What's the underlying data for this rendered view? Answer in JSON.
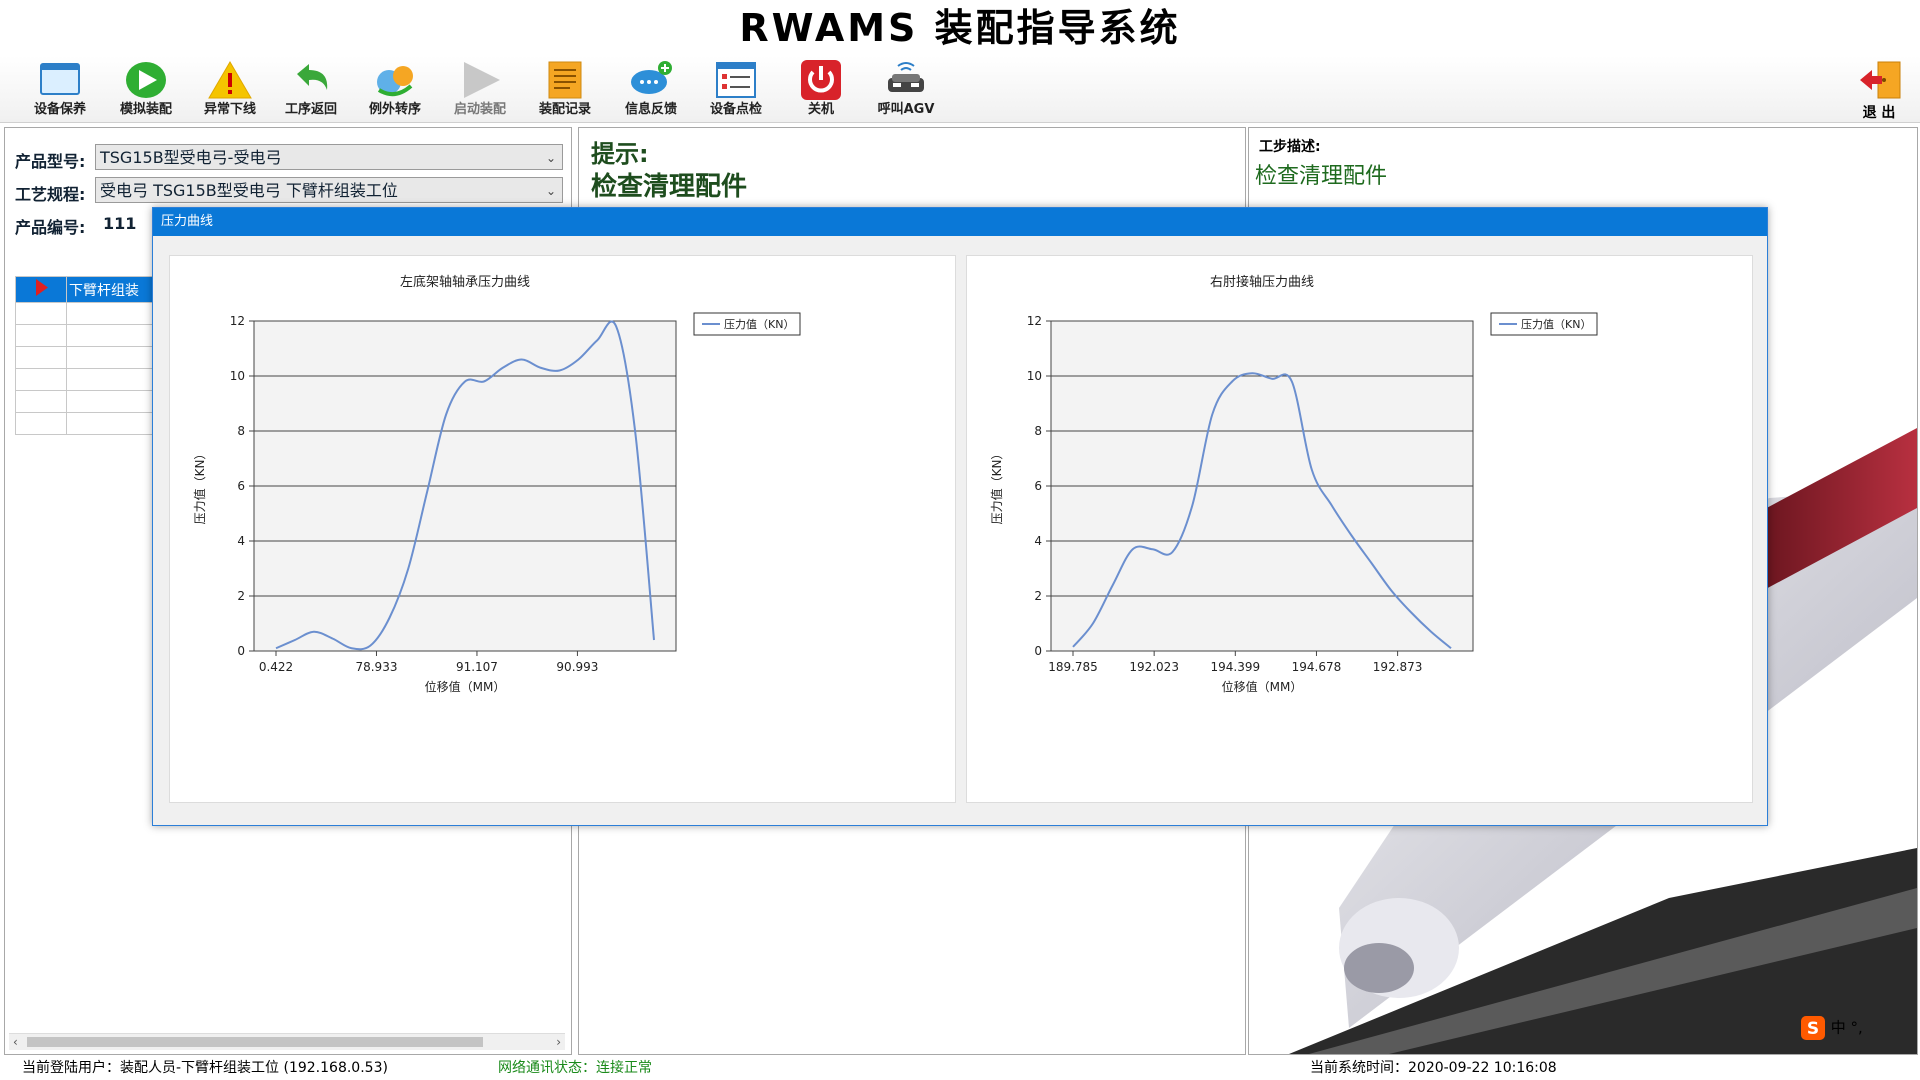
{
  "app": {
    "title": "RWAMS 装配指导系统"
  },
  "toolbar": {
    "items": [
      {
        "label": "设备保养",
        "icon": "monitor-icon"
      },
      {
        "label": "模拟装配",
        "icon": "play-green-icon"
      },
      {
        "label": "异常下线",
        "icon": "warning-icon"
      },
      {
        "label": "工序返回",
        "icon": "return-arrow-icon"
      },
      {
        "label": "例外转序",
        "icon": "exception-transfer-icon"
      },
      {
        "label": "启动装配",
        "icon": "play-disabled-icon"
      },
      {
        "label": "装配记录",
        "icon": "document-icon"
      },
      {
        "label": "信息反馈",
        "icon": "chat-icon"
      },
      {
        "label": "设备点检",
        "icon": "checklist-icon"
      },
      {
        "label": "关机",
        "icon": "power-icon"
      },
      {
        "label": "呼叫AGV",
        "icon": "agv-icon"
      }
    ],
    "exit_label": "退 出"
  },
  "left": {
    "product_model_label": "产品型号:",
    "product_model_value": "TSG15B型受电弓-受电弓",
    "process_label": "工艺规程:",
    "process_value": "受电弓 TSG15B型受电弓 下臂杆组装工位",
    "product_no_label": "产品编号:",
    "product_no_value": "111",
    "table_rows": [
      "下臂杆组装",
      "",
      "",
      "",
      "",
      "",
      ""
    ]
  },
  "middle": {
    "hint_label": "提示:",
    "hint_text": "检查清理配件"
  },
  "right": {
    "step_label": "工步描述:",
    "step_text": "检查清理配件"
  },
  "dialog": {
    "title": "压力曲线"
  },
  "chart_data": [
    {
      "type": "line",
      "title": "左底架轴轴承压力曲线",
      "xlabel": "位移值（MM）",
      "ylabel": "压力值（KN）",
      "ylim": [
        0,
        12
      ],
      "yticks": [
        "0",
        "2",
        "4",
        "6",
        "8",
        "10",
        "12"
      ],
      "xtick_labels": [
        "0.422",
        "78.933",
        "91.107",
        "90.993"
      ],
      "legend": "top-right",
      "grid": true,
      "series": [
        {
          "name": "压力值（KN）",
          "color": "#6b8fcf",
          "values": [
            0.1,
            0.4,
            0.7,
            0.45,
            0.1,
            0.2,
            1.2,
            3.0,
            5.8,
            8.6,
            9.8,
            9.8,
            10.3,
            10.6,
            10.3,
            10.2,
            10.6,
            11.3,
            11.8,
            8.0,
            0.4
          ]
        }
      ]
    },
    {
      "type": "line",
      "title": "右肘接轴压力曲线",
      "xlabel": "位移值（MM）",
      "ylabel": "压力值（KN）",
      "ylim": [
        0,
        12
      ],
      "yticks": [
        "0",
        "2",
        "4",
        "6",
        "8",
        "10",
        "12"
      ],
      "xtick_labels": [
        "189.785",
        "192.023",
        "194.399",
        "194.678",
        "192.873"
      ],
      "legend": "top-right",
      "grid": true,
      "series": [
        {
          "name": "压力值（KN）",
          "color": "#6b8fcf",
          "values": [
            0.15,
            1.0,
            2.4,
            3.7,
            3.7,
            3.6,
            5.3,
            8.6,
            9.8,
            10.1,
            9.9,
            9.8,
            6.6,
            5.3,
            4.2,
            3.2,
            2.2,
            1.4,
            0.7,
            0.1
          ]
        }
      ]
    }
  ],
  "status": {
    "user": "当前登陆用户：装配人员-下臂杆组装工位 (192.168.0.53)",
    "network_label": "网络通讯状态：",
    "network_value": "连接正常",
    "time": "当前系统时间：2020-09-22 10:16:08"
  },
  "ime": {
    "text": "中 °,",
    "icon": "sogou-ime-icon"
  }
}
